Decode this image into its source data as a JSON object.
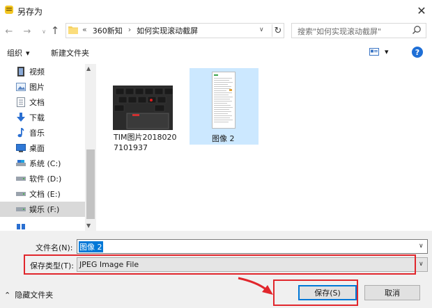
{
  "window": {
    "title": "另存为",
    "icon": "notepad-app-icon",
    "close_glyph": "✕"
  },
  "nav": {
    "back": "←",
    "forward": "→",
    "history": "∨",
    "up": "↑",
    "refresh": "↻",
    "breadcrumb": {
      "overflow": "«",
      "items": [
        "360新知",
        "如何实现滚动截屏"
      ],
      "separator": "›"
    },
    "dropdown": "∨",
    "search_placeholder": "搜索\"如何实现滚动截屏\""
  },
  "toolbar": {
    "organize_label": "组织",
    "organize_caret": "▾",
    "new_folder_label": "新建文件夹",
    "view_caret": "▾",
    "help_label": "?"
  },
  "sidebar": {
    "items": [
      {
        "label": "视频",
        "icon": "video-icon"
      },
      {
        "label": "图片",
        "icon": "pictures-icon"
      },
      {
        "label": "文档",
        "icon": "documents-icon"
      },
      {
        "label": "下载",
        "icon": "download-icon"
      },
      {
        "label": "音乐",
        "icon": "music-icon"
      },
      {
        "label": "桌面",
        "icon": "desktop-icon"
      },
      {
        "label": "系统 (C:)",
        "icon": "drive-icon"
      },
      {
        "label": "软件 (D:)",
        "icon": "drive-icon"
      },
      {
        "label": "文档 (E:)",
        "icon": "drive-icon"
      },
      {
        "label": "娱乐 (F:)",
        "icon": "drive-icon",
        "selected": true
      }
    ]
  },
  "files": [
    {
      "name": "TIM图片20180207101937",
      "type": "image"
    },
    {
      "name": "图像 2",
      "type": "image",
      "selected": true
    }
  ],
  "form": {
    "filename_label": "文件名(N):",
    "filename_value": "图像 2",
    "filetype_label": "保存类型(T):",
    "filetype_value": "JPEG Image File",
    "dropdown_glyph": "∨"
  },
  "footer": {
    "hide_folders_label": "隐藏文件夹",
    "hide_folders_glyph": "⌃",
    "save_label": "保存(S)",
    "cancel_label": "取消"
  },
  "colors": {
    "selection": "#0078d7",
    "highlight_box": "#e1262c",
    "selected_item_bg": "#cce8ff"
  }
}
